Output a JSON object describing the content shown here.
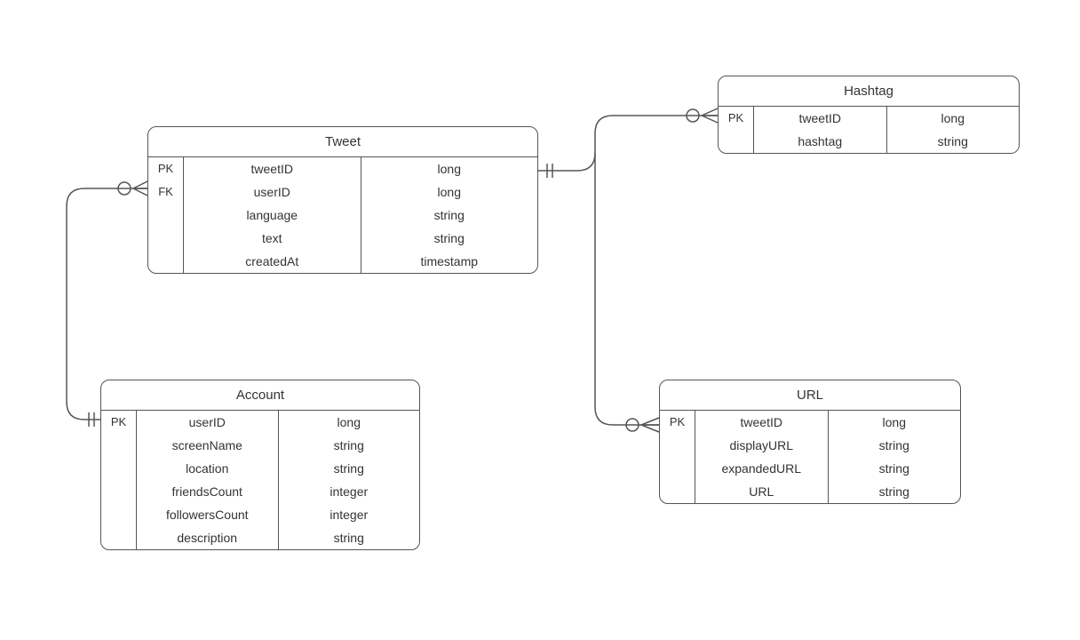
{
  "entities": {
    "tweet": {
      "title": "Tweet",
      "rows": [
        {
          "key": "PK",
          "name": "tweetID",
          "type": "long"
        },
        {
          "key": "FK",
          "name": "userID",
          "type": "long"
        },
        {
          "key": "",
          "name": "language",
          "type": "string"
        },
        {
          "key": "",
          "name": "text",
          "type": "string"
        },
        {
          "key": "",
          "name": "createdAt",
          "type": "timestamp"
        }
      ]
    },
    "account": {
      "title": "Account",
      "rows": [
        {
          "key": "PK",
          "name": "userID",
          "type": "long"
        },
        {
          "key": "",
          "name": "screenName",
          "type": "string"
        },
        {
          "key": "",
          "name": "location",
          "type": "string"
        },
        {
          "key": "",
          "name": "friendsCount",
          "type": "integer"
        },
        {
          "key": "",
          "name": "followersCount",
          "type": "integer"
        },
        {
          "key": "",
          "name": "description",
          "type": "string"
        }
      ]
    },
    "hashtag": {
      "title": "Hashtag",
      "rows": [
        {
          "key": "PK",
          "name": "tweetID",
          "type": "long"
        },
        {
          "key": "",
          "name": "hashtag",
          "type": "string"
        }
      ]
    },
    "url": {
      "title": "URL",
      "rows": [
        {
          "key": "PK",
          "name": "tweetID",
          "type": "long"
        },
        {
          "key": "",
          "name": "displayURL",
          "type": "string"
        },
        {
          "key": "",
          "name": "expandedURL",
          "type": "string"
        },
        {
          "key": "",
          "name": "URL",
          "type": "string"
        }
      ]
    }
  }
}
